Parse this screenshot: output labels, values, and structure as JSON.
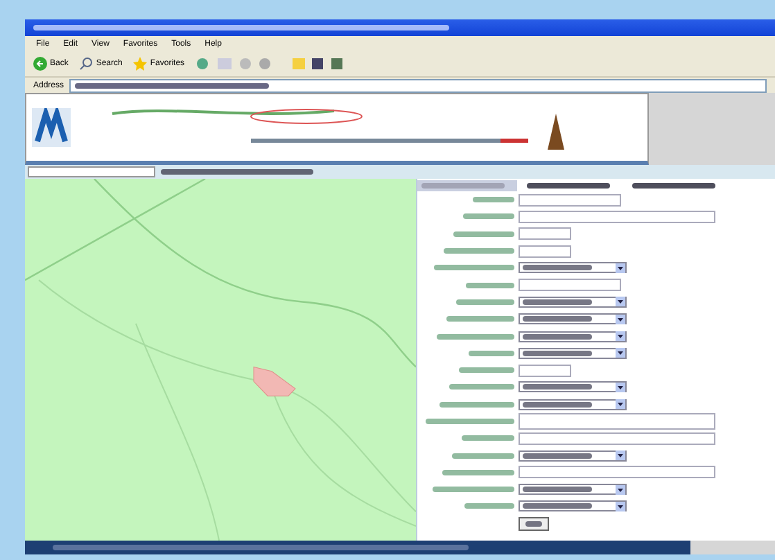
{
  "menu": [
    "File",
    "Edit",
    "View",
    "Favorites",
    "Tools",
    "Help"
  ],
  "toolbar": [
    {
      "kind": "back",
      "label": "Back"
    },
    {
      "kind": "search",
      "label": "Search"
    },
    {
      "kind": "favorites",
      "label": "Favorites"
    }
  ],
  "address": {
    "label": "Address"
  },
  "form": {
    "tabs": [
      {
        "selected": true
      },
      {
        "selected": false
      },
      {
        "selected": false
      }
    ],
    "rows": [
      {
        "kind": "text"
      },
      {
        "kind": "wide"
      },
      {
        "kind": "short"
      },
      {
        "kind": "short"
      },
      {
        "kind": "select"
      },
      {
        "kind": "text"
      },
      {
        "kind": "select"
      },
      {
        "kind": "select"
      },
      {
        "kind": "select"
      },
      {
        "kind": "select"
      },
      {
        "kind": "short"
      },
      {
        "kind": "select"
      },
      {
        "kind": "select"
      },
      {
        "kind": "area"
      },
      {
        "kind": "wide"
      },
      {
        "kind": "select"
      },
      {
        "kind": "wide"
      },
      {
        "kind": "select"
      },
      {
        "kind": "select"
      },
      {
        "kind": "button"
      }
    ]
  }
}
